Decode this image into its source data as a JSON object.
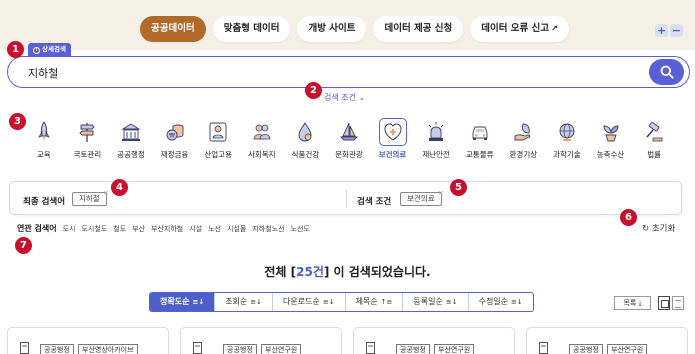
{
  "top_tabs": [
    {
      "label": "공공데이터",
      "active": true
    },
    {
      "label": "맞춤형 데이터",
      "active": false
    },
    {
      "label": "개방 사이트",
      "active": false
    },
    {
      "label": "데이터 제공 신청",
      "active": false
    },
    {
      "label": "데이터 오류 신고",
      "active": false,
      "external": true
    }
  ],
  "zoom": {
    "plus": "+",
    "minus": "−"
  },
  "badges": [
    "1",
    "2",
    "3",
    "4",
    "5",
    "6",
    "7"
  ],
  "advanced_search_label": "상세검색",
  "search": {
    "value": "지하철",
    "icon": "search-icon"
  },
  "condition_toggle": "검색 조건",
  "categories": [
    {
      "label": "교육",
      "icon": "rocket-icon"
    },
    {
      "label": "국토관리",
      "icon": "signpost-icon"
    },
    {
      "label": "공공행정",
      "icon": "government-building-icon"
    },
    {
      "label": "재정금융",
      "icon": "coins-icon"
    },
    {
      "label": "산업고용",
      "icon": "worker-icon"
    },
    {
      "label": "사회복지",
      "icon": "people-icon"
    },
    {
      "label": "식품건강",
      "icon": "drop-icon"
    },
    {
      "label": "문화관광",
      "icon": "sailboat-icon"
    },
    {
      "label": "보건의료",
      "icon": "heart-shield-icon",
      "active": true
    },
    {
      "label": "재난안전",
      "icon": "siren-icon"
    },
    {
      "label": "교통물류",
      "icon": "car-icon"
    },
    {
      "label": "환경기상",
      "icon": "leaf-hand-icon"
    },
    {
      "label": "과학기술",
      "icon": "globe-icon"
    },
    {
      "label": "농축수산",
      "icon": "plant-icon"
    },
    {
      "label": "법률",
      "icon": "gavel-icon"
    }
  ],
  "summary": {
    "final_keyword_label": "최종 검색어",
    "final_keyword": "지하철",
    "condition_label": "검색 조건",
    "condition_value": "보건의료"
  },
  "reset_label": "초기화",
  "related": {
    "label": "연관 검색어",
    "keywords": [
      "도시",
      "도시철도",
      "철도",
      "부산",
      "부산지하철",
      "시설",
      "노선",
      "시설물",
      "지하철노선",
      "노선도"
    ]
  },
  "result": {
    "prefix": "전체 [",
    "count": "25건",
    "suffix": "] 이 검색되었습니다."
  },
  "sort_options": [
    {
      "label": "정확도순",
      "active": true
    },
    {
      "label": "조회순",
      "active": false
    },
    {
      "label": "다운로드순",
      "active": false
    },
    {
      "label": "제목순",
      "active": false
    },
    {
      "label": "등록일순",
      "active": false
    },
    {
      "label": "수정일순",
      "active": false
    }
  ],
  "list_button": "목록",
  "cards": [
    {
      "tags": [
        "공공행정",
        "부산영상아카이브"
      ]
    },
    {
      "tags": [
        "공공행정",
        "부산연구원"
      ]
    },
    {
      "tags": [
        "공공행정",
        "부산연구원"
      ]
    },
    {
      "tags": [
        "공공행정",
        "부산연구원"
      ]
    }
  ],
  "colors": {
    "accent": "#5a5fd6",
    "brand_tab": "#b06a2a",
    "badge": "#c8102e",
    "hero_bg": "#f6efe6"
  }
}
